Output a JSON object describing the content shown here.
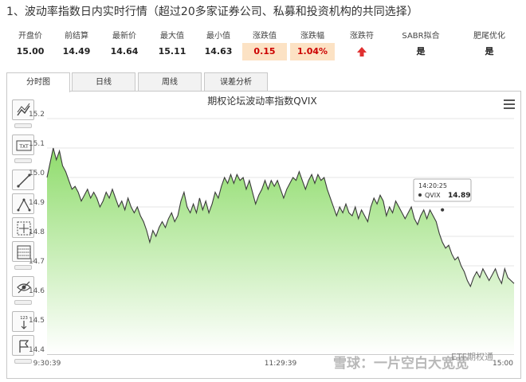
{
  "heading": "1、波动率指数日内实时行情（超过20多家证券公司、私募和投资机构的共同选择）",
  "stats": [
    {
      "label": "开盘价",
      "value": "15.00"
    },
    {
      "label": "前结算",
      "value": "14.49"
    },
    {
      "label": "最新价",
      "value": "14.64"
    },
    {
      "label": "最大值",
      "value": "15.11"
    },
    {
      "label": "最小值",
      "value": "14.63"
    },
    {
      "label": "涨跌值",
      "value": "0.15"
    },
    {
      "label": "涨跌幅",
      "value": "1.04%"
    },
    {
      "label": "涨跌符",
      "value": "up-arrow-icon"
    },
    {
      "label": "SABR拟合",
      "value": "是"
    },
    {
      "label": "肥尾优化",
      "value": "是"
    }
  ],
  "colors": {
    "accent_up": "#e03030",
    "highlight_bg": "#fce2c4",
    "line": "#3a3a3a",
    "fill_top": "#8fdc6c",
    "fill_bottom": "#ffffff"
  },
  "tabs": [
    "分时图",
    "日线",
    "周线",
    "误差分析"
  ],
  "tools": [
    "trend-line-icon",
    "text-icon",
    "line-icon",
    "fibonacci-icon",
    "crosshair-icon",
    "grid-lines-icon",
    "hide-icon",
    "measure-icon",
    "flag-icon"
  ],
  "tool_labels": {
    "text": "TXT",
    "measure": "123"
  },
  "chart_data": {
    "type": "area",
    "title": "期权论坛波动率指数QVIX",
    "xlabel": "",
    "ylabel": "",
    "x_ticks": [
      "9:30:39",
      "11:29:39",
      "15:00"
    ],
    "ylim": [
      14.4,
      15.2
    ],
    "y_ticks": [
      14.4,
      14.5,
      14.6,
      14.7,
      14.8,
      14.9,
      15.0,
      15.1,
      15.2
    ],
    "grid": true,
    "tooltip": {
      "time": "14:20:25",
      "series": "QVIX",
      "value": "14.89"
    },
    "values": [
      15.0,
      15.05,
      15.1,
      15.06,
      15.09,
      15.04,
      15.02,
      14.99,
      14.96,
      14.97,
      14.95,
      14.92,
      14.94,
      14.96,
      14.93,
      14.95,
      14.93,
      14.9,
      14.92,
      14.95,
      14.93,
      14.96,
      14.93,
      14.9,
      14.92,
      14.89,
      14.93,
      14.9,
      14.88,
      14.9,
      14.87,
      14.85,
      14.82,
      14.78,
      14.82,
      14.8,
      14.83,
      14.85,
      14.83,
      14.86,
      14.88,
      14.85,
      14.87,
      14.92,
      14.95,
      14.9,
      14.88,
      14.91,
      14.88,
      14.93,
      14.89,
      14.92,
      14.88,
      14.91,
      14.95,
      14.93,
      14.97,
      15.0,
      14.98,
      15.01,
      14.98,
      15.01,
      14.99,
      15.0,
      14.96,
      14.99,
      14.95,
      14.91,
      14.94,
      14.96,
      14.99,
      14.96,
      14.99,
      14.97,
      14.99,
      14.96,
      14.93,
      14.96,
      14.98,
      15.0,
      14.99,
      15.02,
      14.99,
      14.96,
      14.99,
      15.01,
      14.98,
      15.01,
      14.99,
      15.0,
      14.96,
      14.93,
      14.9,
      14.87,
      14.9,
      14.88,
      14.91,
      14.88,
      14.87,
      14.9,
      14.86,
      14.89,
      14.87,
      14.85,
      14.9,
      14.93,
      14.91,
      14.94,
      14.92,
      14.87,
      14.9,
      14.88,
      14.92,
      14.9,
      14.88,
      14.86,
      14.88,
      14.9,
      14.86,
      14.84,
      14.87,
      14.89,
      14.86,
      14.89,
      14.87,
      14.85,
      14.81,
      14.78,
      14.76,
      14.77,
      14.74,
      14.72,
      14.73,
      14.7,
      14.68,
      14.65,
      14.63,
      14.66,
      14.68,
      14.66,
      14.69,
      14.67,
      14.65,
      14.67,
      14.69,
      14.66,
      14.64,
      14.69,
      14.66,
      14.65,
      14.64
    ]
  },
  "watermark": {
    "main": "雪球：一片空白大宽宽",
    "sub": "ETF期权通"
  }
}
